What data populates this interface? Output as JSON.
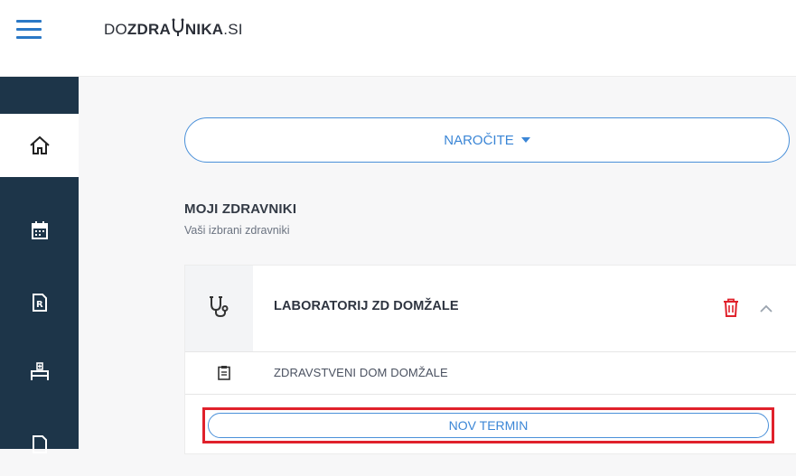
{
  "header": {
    "logo_prefix": "DO",
    "logo_main_a": "ZDRA",
    "logo_main_b": "NIKA",
    "logo_suffix": ".SI"
  },
  "sidebar": {
    "items": [
      {
        "icon": "home-icon",
        "active": true
      },
      {
        "icon": "calendar-icon",
        "active": false
      },
      {
        "icon": "prescription-document-icon",
        "active": false
      },
      {
        "icon": "hospital-bed-icon",
        "active": false
      },
      {
        "icon": "document-icon",
        "active": false
      }
    ]
  },
  "main": {
    "order_button_label": "NAROČITE",
    "section_title": "MOJI ZDRAVNIKI",
    "section_subtitle": "Vaši izbrani zdravniki",
    "card": {
      "title": "LABORATORIJ ZD DOMŽALE",
      "location": "ZDRAVSTVENI DOM DOMŽALE",
      "new_appointment_label": "NOV TERMIN"
    }
  },
  "colors": {
    "accent": "#3b86d6",
    "sidebar_bg": "#1d3549",
    "danger": "#e0212b"
  }
}
